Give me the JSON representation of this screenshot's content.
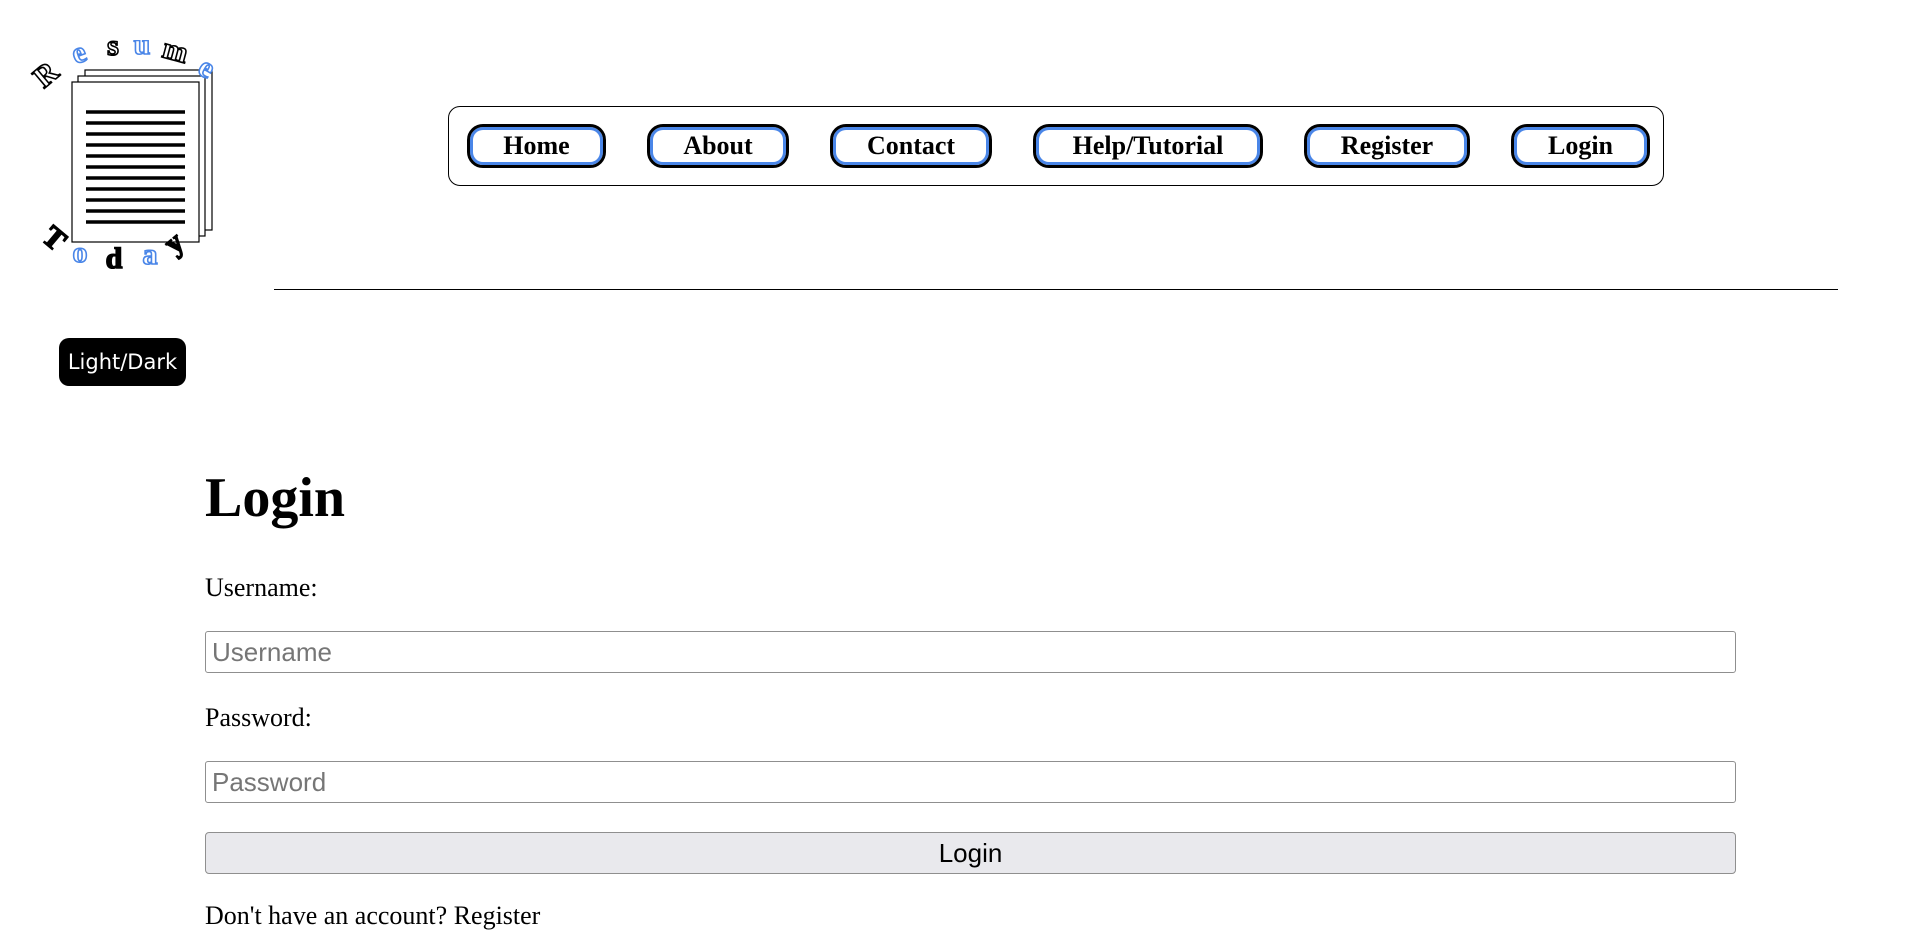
{
  "logo": {
    "top_letters": [
      "R",
      "e",
      "s",
      "u",
      "m",
      "e"
    ],
    "bottom_letters": [
      "T",
      "o",
      "d",
      "a",
      "y"
    ],
    "colors": {
      "dark": "#000000",
      "accent": "#4a86e8"
    }
  },
  "nav": {
    "items": [
      {
        "label": "Home"
      },
      {
        "label": "About"
      },
      {
        "label": "Contact"
      },
      {
        "label": "Help/Tutorial"
      },
      {
        "label": "Register"
      },
      {
        "label": "Login"
      }
    ],
    "accent_color": "#4a86e8"
  },
  "theme_toggle": {
    "label": "Light/Dark"
  },
  "form": {
    "title": "Login",
    "username_label": "Username:",
    "username_placeholder": "Username",
    "username_value": "",
    "password_label": "Password:",
    "password_placeholder": "Password",
    "password_value": "",
    "submit_label": "Login",
    "footer_text": "Don't have an account? Register"
  }
}
